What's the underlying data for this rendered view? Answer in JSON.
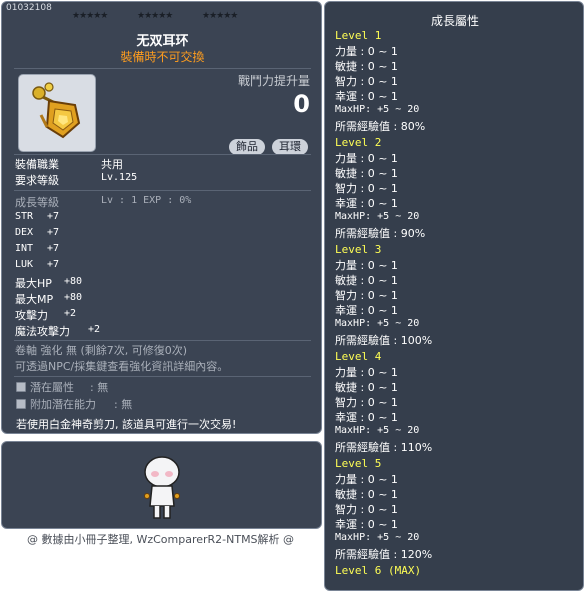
{
  "item": {
    "id": "01032108",
    "name": "无双耳环",
    "untradeable_note": "裝備時不可交換",
    "combat_power_label": "戰鬥力提升量",
    "combat_power_value": "0",
    "tags": [
      "飾品",
      "耳環"
    ],
    "stars": [
      "★★★★★",
      "★★★★★",
      "★★★★★"
    ]
  },
  "requirements": [
    {
      "label": "裝備職業",
      "value": "共用"
    },
    {
      "label": "要求等級",
      "value": "Lv.125"
    }
  ],
  "growth_line": {
    "label": "成長等級",
    "value": "Lv : 1  EXP : 0%"
  },
  "stats": [
    {
      "label": "STR",
      "value": "+7"
    },
    {
      "label": "DEX",
      "value": "+7"
    },
    {
      "label": "INT",
      "value": "+7"
    },
    {
      "label": "LUK",
      "value": "+7"
    },
    {
      "label": "最大HP",
      "value": "+80"
    },
    {
      "label": "最大MP",
      "value": "+80"
    },
    {
      "label": "攻擊力",
      "value": "+2"
    },
    {
      "label": "魔法攻擊力",
      "value": "+2"
    }
  ],
  "enhancement": {
    "line1": "卷軸 強化 無 (剩餘7次, 可修復0次)",
    "line2": "可透過NPC/採集鍵查看強化資訊詳細內容。"
  },
  "potentials": [
    {
      "label": "潛在屬性",
      "value": ": 無"
    },
    {
      "label": "附加潛在能力",
      "value": ": 無"
    }
  ],
  "scissors_note": "若使用白金神奇剪刀, 該道具可進行一次交易!",
  "credit": "@ 數據由小冊子整理, WzComparerR2-NTMS解析 @",
  "growth": {
    "title": "成長屬性",
    "levels": [
      {
        "name": "Level 1",
        "stats": [
          "力量 : 0 ~ 1",
          "敏捷 : 0 ~ 1",
          "智力 : 0 ~ 1",
          "幸運 : 0 ~ 1"
        ],
        "maxhp": "MaxHP:  +5 ~ 20",
        "exp": "所需經驗值 : 80%"
      },
      {
        "name": "Level 2",
        "stats": [
          "力量 : 0 ~ 1",
          "敏捷 : 0 ~ 1",
          "智力 : 0 ~ 1",
          "幸運 : 0 ~ 1"
        ],
        "maxhp": "MaxHP:  +5 ~ 20",
        "exp": "所需經驗值 : 90%"
      },
      {
        "name": "Level 3",
        "stats": [
          "力量 : 0 ~ 1",
          "敏捷 : 0 ~ 1",
          "智力 : 0 ~ 1",
          "幸運 : 0 ~ 1"
        ],
        "maxhp": "MaxHP:  +5 ~ 20",
        "exp": "所需經驗值 : 100%"
      },
      {
        "name": "Level 4",
        "stats": [
          "力量 : 0 ~ 1",
          "敏捷 : 0 ~ 1",
          "智力 : 0 ~ 1",
          "幸運 : 0 ~ 1"
        ],
        "maxhp": "MaxHP:  +5 ~ 20",
        "exp": "所需經驗值 : 110%"
      },
      {
        "name": "Level 5",
        "stats": [
          "力量 : 0 ~ 1",
          "敏捷 : 0 ~ 1",
          "智力 : 0 ~ 1",
          "幸運 : 0 ~ 1"
        ],
        "maxhp": "MaxHP:  +5 ~ 20",
        "exp": "所需經驗值 : 120%"
      }
    ],
    "final_level": "Level 6 (MAX)"
  }
}
